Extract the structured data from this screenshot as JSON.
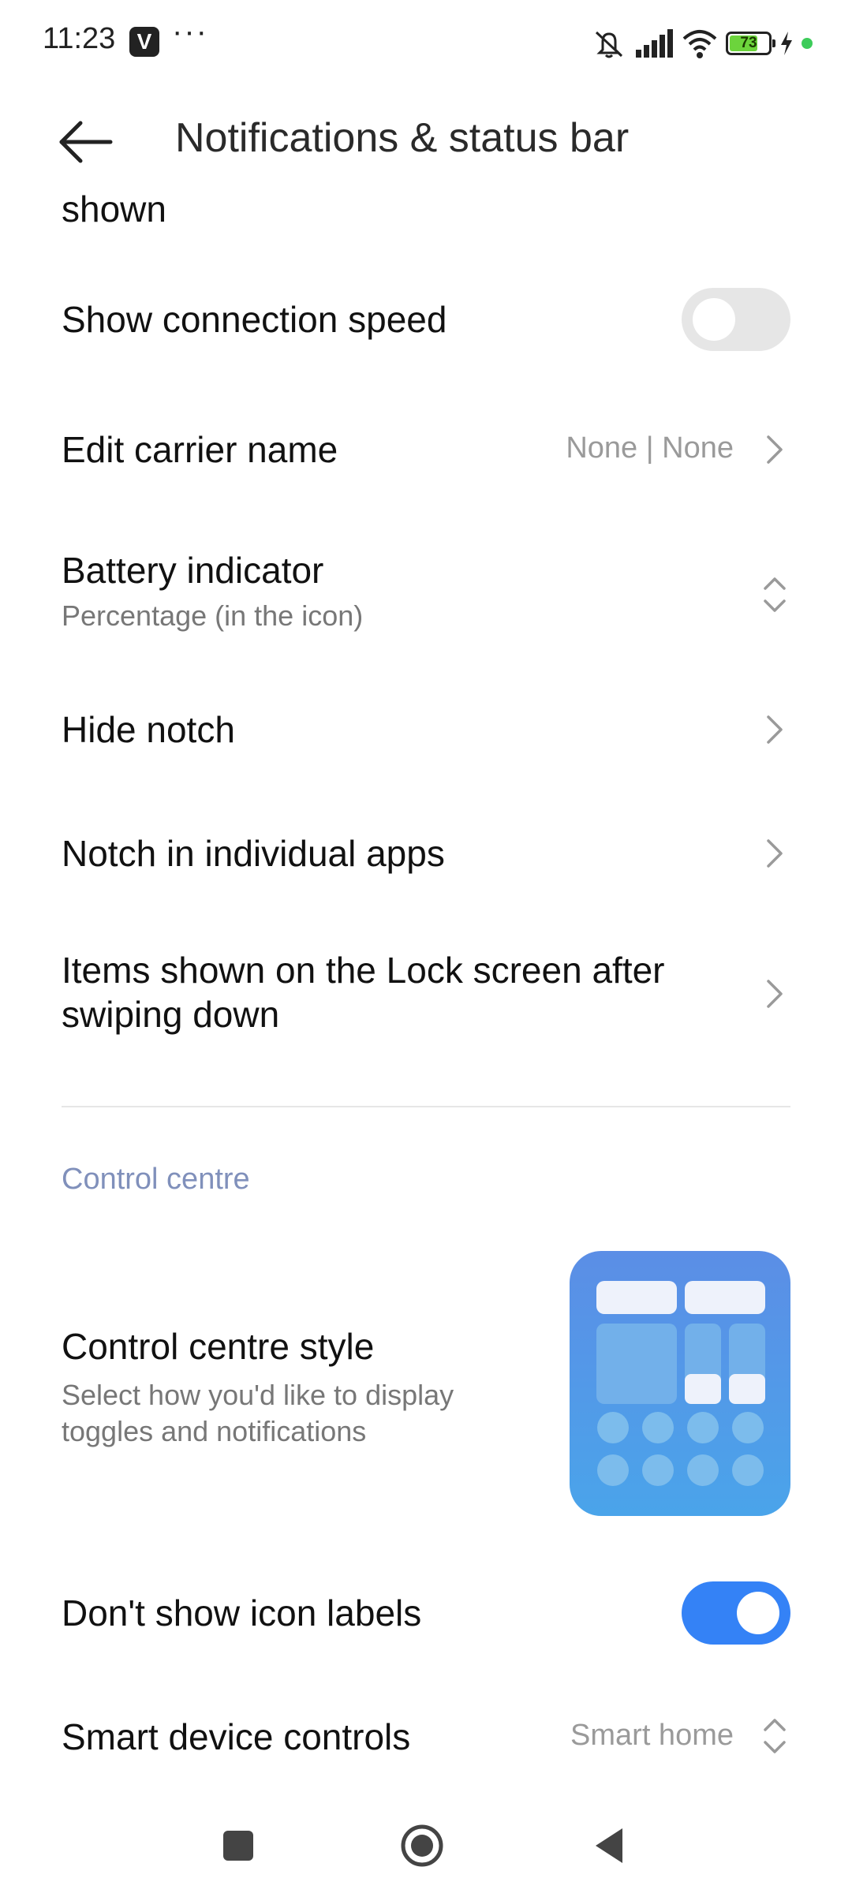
{
  "status_bar": {
    "time": "11:23",
    "app_icon_letter": "V",
    "more_indicator": "···",
    "battery_level": "73",
    "battery_percent": 0.73,
    "icons": [
      "mute-icon",
      "signal-icon",
      "wifi-icon",
      "battery-icon",
      "charging-icon",
      "green-dot-icon"
    ]
  },
  "header": {
    "title": "Notifications & status bar"
  },
  "partial_row": {
    "text": "shown"
  },
  "rows": {
    "connection_speed": {
      "title": "Show connection speed",
      "toggle": false
    },
    "carrier_name": {
      "title": "Edit carrier name",
      "value": "None | None"
    },
    "battery_indicator": {
      "title": "Battery indicator",
      "subtitle": "Percentage (in the icon)"
    },
    "hide_notch": {
      "title": "Hide notch"
    },
    "notch_apps": {
      "title": "Notch in individual apps"
    },
    "lock_items": {
      "title_line1": "Items shown on the Lock screen after",
      "title_line2": "swiping down"
    }
  },
  "section": {
    "control_centre": "Control centre"
  },
  "control_centre": {
    "style": {
      "title": "Control centre style",
      "subtitle_line1": "Select how you'd like to display",
      "subtitle_line2": "toggles and notifications"
    },
    "icon_labels": {
      "title": "Don't show icon labels",
      "toggle": true
    },
    "smart_device": {
      "title": "Smart device controls",
      "value": "Smart home"
    }
  },
  "colors": {
    "accent": "#3482f6",
    "section_header": "#8090bb",
    "secondary_text": "#777777",
    "value_text": "#9a9a9a"
  }
}
